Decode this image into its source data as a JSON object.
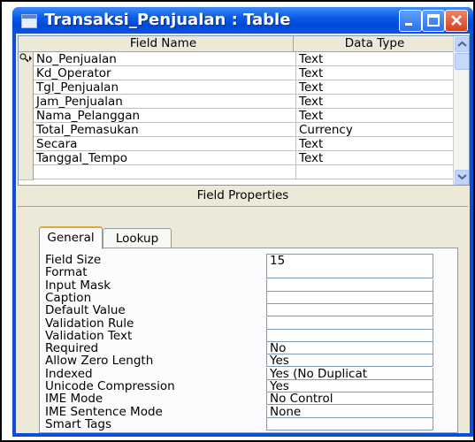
{
  "window": {
    "title": "Transaksi_Penjualan : Table"
  },
  "grid": {
    "columns": {
      "field_name": "Field Name",
      "data_type": "Data Type"
    },
    "rows": [
      {
        "name": "No_Penjualan",
        "type": "Text",
        "primary_key": true
      },
      {
        "name": "Kd_Operator",
        "type": "Text"
      },
      {
        "name": "Tgl_Penjualan",
        "type": "Text"
      },
      {
        "name": "Jam_Penjualan",
        "type": "Text"
      },
      {
        "name": "Nama_Pelanggan",
        "type": "Text"
      },
      {
        "name": "Total_Pemasukan",
        "type": "Currency"
      },
      {
        "name": "Secara",
        "type": "Text"
      },
      {
        "name": "Tanggal_Tempo",
        "type": "Text"
      }
    ]
  },
  "field_properties": {
    "label": "Field Properties",
    "tabs": [
      "General",
      "Lookup"
    ],
    "active_tab": "General",
    "props": [
      {
        "label": "Field Size",
        "value": "15"
      },
      {
        "label": "Format",
        "value": ""
      },
      {
        "label": "Input Mask",
        "value": ""
      },
      {
        "label": "Caption",
        "value": ""
      },
      {
        "label": "Default Value",
        "value": ""
      },
      {
        "label": "Validation Rule",
        "value": ""
      },
      {
        "label": "Validation Text",
        "value": ""
      },
      {
        "label": "Required",
        "value": "No"
      },
      {
        "label": "Allow Zero Length",
        "value": "Yes"
      },
      {
        "label": "Indexed",
        "value": "Yes (No Duplicat"
      },
      {
        "label": "Unicode Compression",
        "value": "Yes"
      },
      {
        "label": "IME Mode",
        "value": "No Control"
      },
      {
        "label": "IME Sentence Mode",
        "value": "None"
      },
      {
        "label": "Smart Tags",
        "value": ""
      }
    ]
  },
  "icons": {
    "title": "table-icon",
    "minimize": "minimize-icon",
    "maximize": "maximize-icon",
    "close": "close-icon",
    "key": "primary-key-icon",
    "scroll_up": "scroll-up-arrow-icon",
    "scroll_down": "scroll-down-arrow-icon"
  },
  "colors": {
    "titlebar": "#0a4fd6",
    "close_button": "#d4401c",
    "body": "#ece9d8",
    "active_tab_accent": "#e8a33c"
  }
}
